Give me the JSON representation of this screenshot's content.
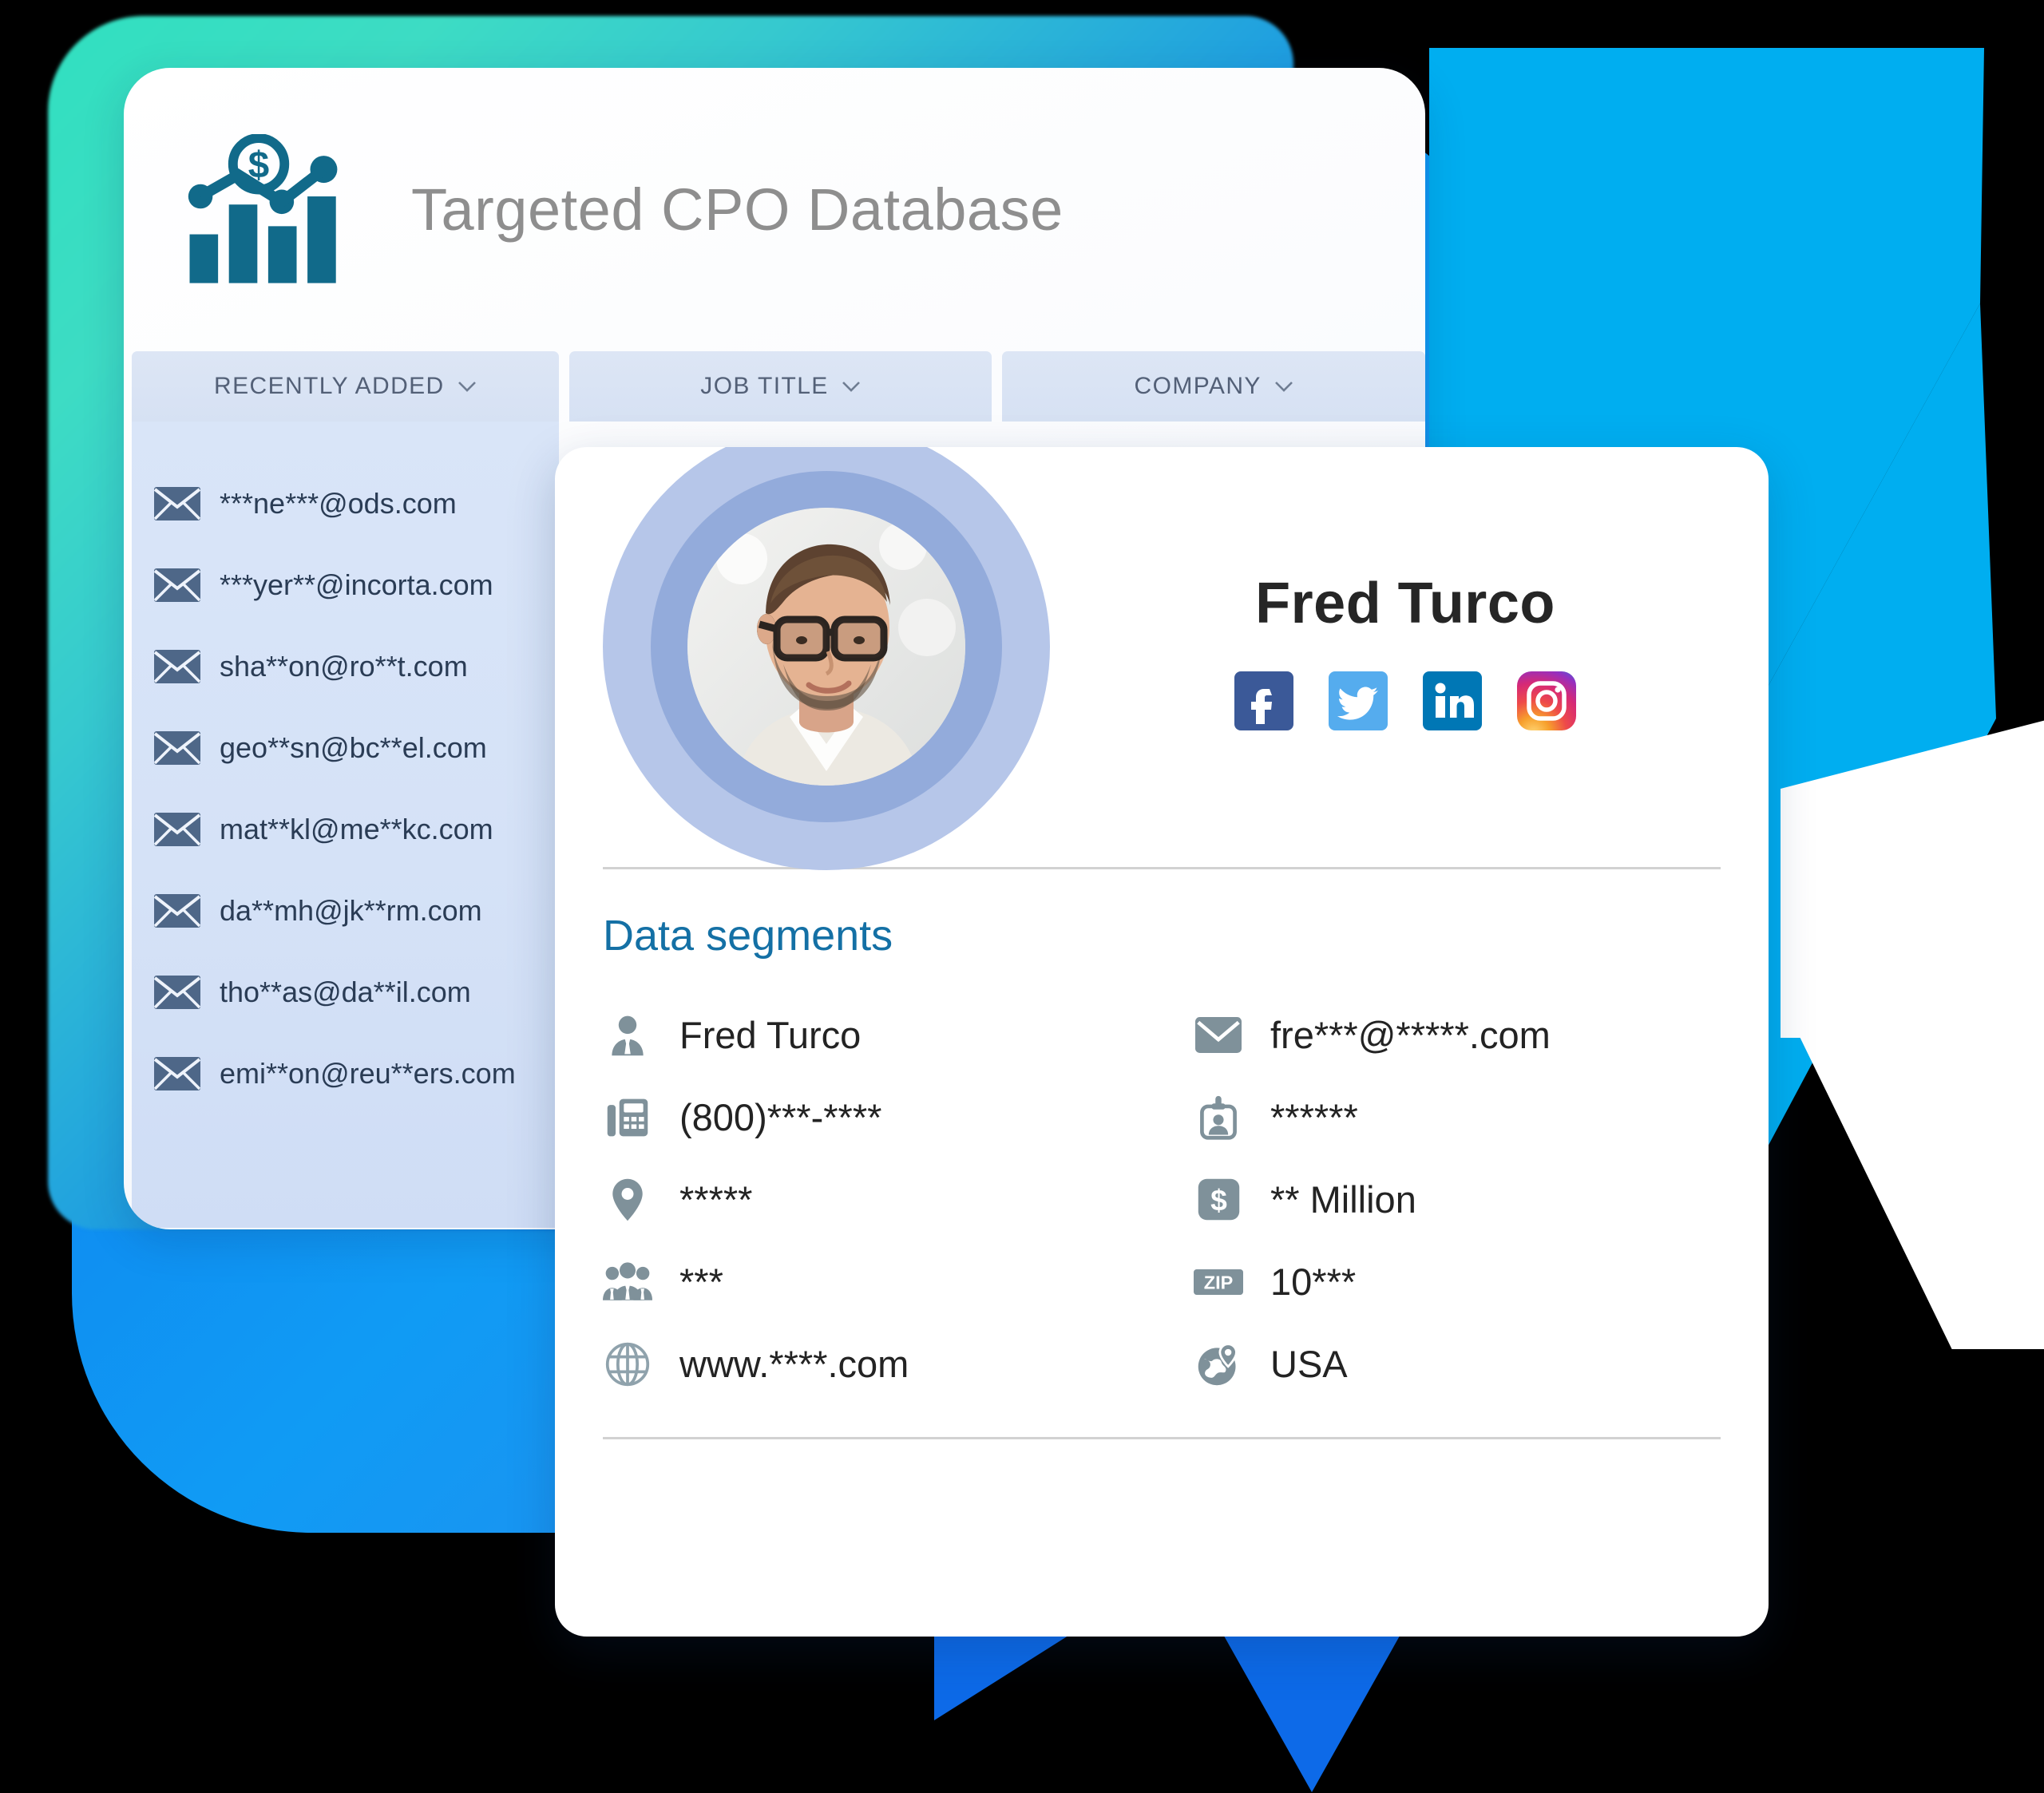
{
  "app": {
    "title": "Targeted CPO Database",
    "logo_icon": "bar-chart-dollar-icon"
  },
  "colors": {
    "accent_teal": "#1470a5",
    "logo_blue": "#116a8a",
    "header_bg": "#dde6f5",
    "panel_bg": "#d9e5f8",
    "cyan_shape": "#00aef0",
    "blue_shape": "#0d6ae8",
    "teal_glow": "#31e0c0",
    "avatar_ring_outer": "#b6c6e9",
    "avatar_ring_inner": "#93abdb",
    "facebook": "#3b5998",
    "twitter": "#55acee",
    "linkedin": "#0077b5",
    "instagram": "#d62976"
  },
  "columns": [
    {
      "label": "RECENTLY ADDED",
      "icon": "chevron-down-icon"
    },
    {
      "label": "JOB TITLE",
      "icon": "chevron-down-icon"
    },
    {
      "label": "COMPANY",
      "icon": "chevron-down-icon"
    }
  ],
  "recently_added": [
    {
      "icon": "envelope-icon",
      "email": "***ne***@ods.com"
    },
    {
      "icon": "envelope-icon",
      "email": "***yer**@incorta.com"
    },
    {
      "icon": "envelope-icon",
      "email": "sha**on@ro**t.com"
    },
    {
      "icon": "envelope-icon",
      "email": "geo**sn@bc**el.com"
    },
    {
      "icon": "envelope-icon",
      "email": "mat**kl@me**kc.com"
    },
    {
      "icon": "envelope-icon",
      "email": "da**mh@jk**rm.com"
    },
    {
      "icon": "envelope-icon",
      "email": "tho**as@da**il.com"
    },
    {
      "icon": "envelope-icon",
      "email": "emi**on@reu**ers.com"
    }
  ],
  "profile": {
    "name": "Fred Turco",
    "avatar_alt": "profile-photo",
    "socials": [
      {
        "name": "facebook-icon",
        "label": "Facebook"
      },
      {
        "name": "twitter-icon",
        "label": "Twitter"
      },
      {
        "name": "linkedin-icon",
        "label": "LinkedIn"
      },
      {
        "name": "instagram-icon",
        "label": "Instagram"
      }
    ],
    "segments_title": "Data segments",
    "segments_left": [
      {
        "icon": "person-tie-icon",
        "value": "Fred Turco"
      },
      {
        "icon": "fax-phone-icon",
        "value": "(800)***-****"
      },
      {
        "icon": "location-pin-icon",
        "value": "*****"
      },
      {
        "icon": "people-group-icon",
        "value": "***"
      },
      {
        "icon": "globe-grid-icon",
        "value": "www.****.com"
      }
    ],
    "segments_right": [
      {
        "icon": "envelope-icon",
        "value": "fre***@*****.com"
      },
      {
        "icon": "id-badge-icon",
        "value": "******"
      },
      {
        "icon": "dollar-square-icon",
        "value": "** Million"
      },
      {
        "icon": "zip-badge-icon",
        "value": "10***"
      },
      {
        "icon": "globe-pin-icon",
        "value": "USA"
      }
    ]
  }
}
